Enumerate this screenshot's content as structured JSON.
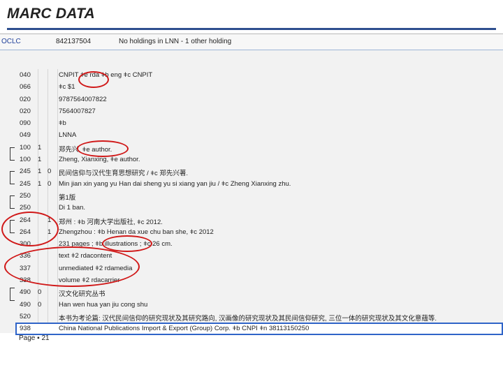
{
  "slide": {
    "title": "MARC DATA",
    "page_label": "Page ",
    "page_number": "21",
    "accent": "#2e4f8f"
  },
  "oclc_bar": {
    "label": "OCLC",
    "number": "842137504",
    "holdings": "No holdings in LNN - 1 other holding"
  },
  "rows": [
    {
      "tag": "040",
      "ind1": "",
      "ind2": "",
      "text": "CNPIT ǂe rda ǂb eng ǂc CNPIT"
    },
    {
      "tag": "066",
      "ind1": "",
      "ind2": "",
      "text": "ǂc $1"
    },
    {
      "tag": "020",
      "ind1": "",
      "ind2": "",
      "text": "9787564007822"
    },
    {
      "tag": "020",
      "ind1": "",
      "ind2": "",
      "text": "7564007827"
    },
    {
      "tag": "090",
      "ind1": "",
      "ind2": "",
      "text": "ǂb"
    },
    {
      "tag": "049",
      "ind1": "",
      "ind2": "",
      "text": "LNNA"
    },
    {
      "tag": "100",
      "ind1": "1",
      "ind2": "",
      "text": "郑先兴, ǂe author."
    },
    {
      "tag": "100",
      "ind1": "1",
      "ind2": "",
      "text": "Zheng, Xianxing, ǂe author."
    },
    {
      "tag": "245",
      "ind1": "1",
      "ind2": "0",
      "text": "民间信仰与汉代生育思想研究 / ǂc 郑先兴著."
    },
    {
      "tag": "245",
      "ind1": "1",
      "ind2": "0",
      "text": "Min jian xin yang yu Han dai sheng yu si xiang yan jiu / ǂc Zheng Xianxing zhu."
    },
    {
      "tag": "250",
      "ind1": "",
      "ind2": "",
      "text": "第1版"
    },
    {
      "tag": "250",
      "ind1": "",
      "ind2": "",
      "text": "Di 1 ban."
    },
    {
      "tag": "264",
      "ind1": "",
      "ind2": "1",
      "text": "郑州 : ǂb 河南大学出版社, ǂc 2012."
    },
    {
      "tag": "264",
      "ind1": "",
      "ind2": "1",
      "text": "Zhengzhou : ǂb Henan da xue chu ban she, ǂc 2012"
    },
    {
      "tag": "300",
      "ind1": "",
      "ind2": "",
      "text": "231 pages ; ǂb illustrations ; ǂc 26 cm."
    },
    {
      "tag": "336",
      "ind1": "",
      "ind2": "",
      "text": "text ǂ2 rdacontent"
    },
    {
      "tag": "337",
      "ind1": "",
      "ind2": "",
      "text": "unmediated ǂ2 rdamedia"
    },
    {
      "tag": "338",
      "ind1": "",
      "ind2": "",
      "text": "volume ǂ2 rdacarrier"
    },
    {
      "tag": "490",
      "ind1": "0",
      "ind2": "",
      "text": "汉文化研究丛书"
    },
    {
      "tag": "490",
      "ind1": "0",
      "ind2": "",
      "text": "Han wen hua yan jiu cong shu"
    },
    {
      "tag": "520",
      "ind1": "",
      "ind2": "",
      "text": "本书为考论篇: 汉代民间信仰的研究现状及其研究路向, 汉画像的研究现状及其民间信仰研究, 三位一体的研究现状及其文化意蕴等."
    },
    {
      "tag": "938",
      "ind1": "",
      "ind2": "",
      "text": "China National Publications Import & Export (Group) Corp. ǂb CNPI ǂn 38113150250"
    }
  ]
}
